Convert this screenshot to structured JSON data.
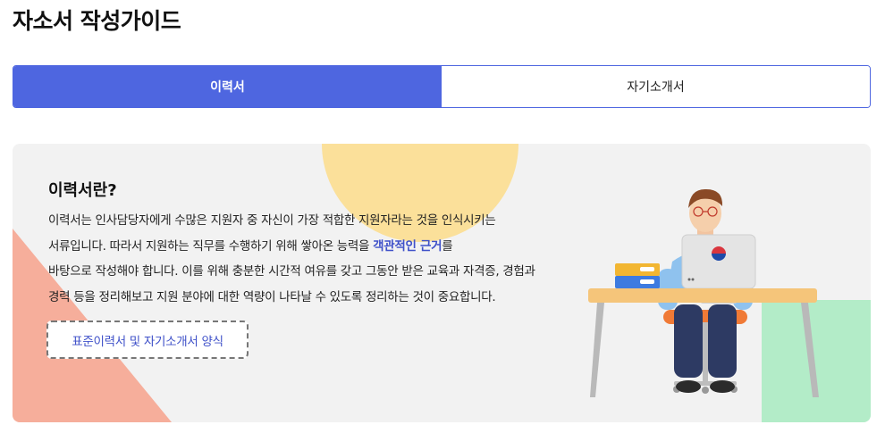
{
  "page": {
    "title": "자소서 작성가이드"
  },
  "tabs": [
    {
      "label": "이력서",
      "active": true
    },
    {
      "label": "자기소개서",
      "active": false
    }
  ],
  "card": {
    "heading": "이력서란?",
    "lines": [
      {
        "text": "이력서는 인사담당자에게 수많은 지원자 중 자신이 가장 적합한 지원자라는 것을 인식시키는"
      },
      {
        "before": "서류입니다. 따라서 지원하는 직무를 수행하기 위해 쌓아온 능력을 ",
        "highlight": "객관적인 근거",
        "after": "를"
      },
      {
        "text": "바탕으로 작성해야 합니다. 이를 위해 충분한 시간적 여유를 갖고 그동안 받은 교육과 자격증, 경험과"
      },
      {
        "text": "경력 등을 정리해보고 지원 분야에 대한 역량이 나타날 수 있도록 정리하는 것이 중요합니다."
      }
    ],
    "button_label": "표준이력서 및 자기소개서 양식"
  },
  "colors": {
    "accent": "#4e66e0",
    "highlight": "#3f51c9",
    "card_bg": "#f2f2f2",
    "deco_circle": "#fbe09a",
    "deco_triangle": "#f6ae9b",
    "deco_square": "#b3ecc8"
  },
  "icons": [
    "person-at-desk-illustration",
    "government-logo-icon"
  ]
}
